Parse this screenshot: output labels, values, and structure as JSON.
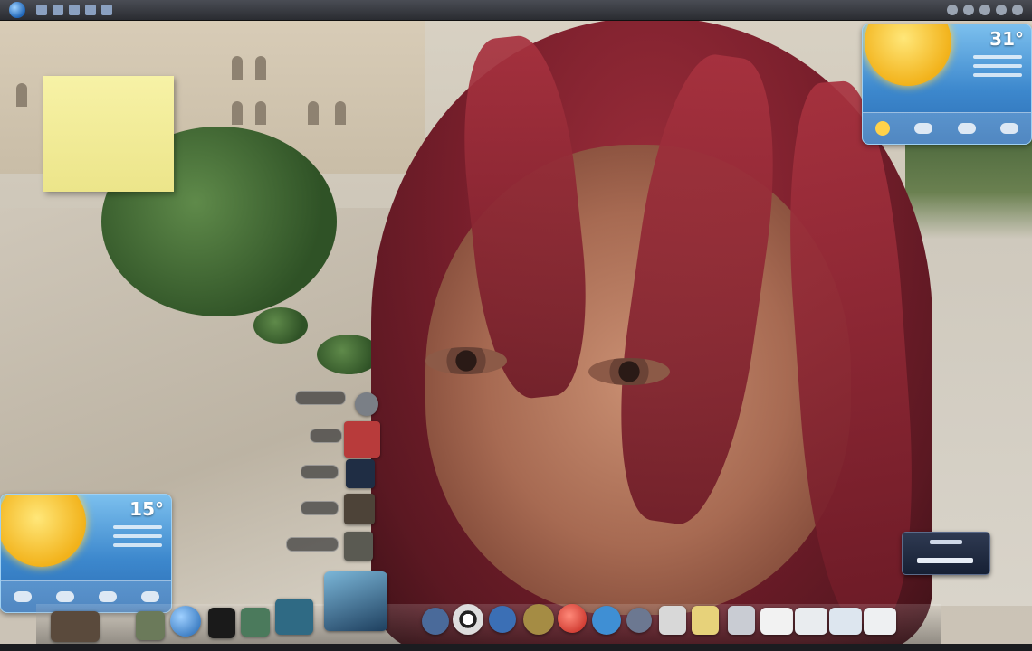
{
  "desktop": {
    "wallpaper": "photo-portrait-red-hair"
  },
  "taskbar": {
    "start_icon": "windows-orb-icon",
    "quick_launch_count": 5,
    "tray_icon_count": 5
  },
  "gadgets": {
    "sticky_note": {
      "lines": [
        "",
        "",
        "",
        ""
      ]
    },
    "weather_top": {
      "temperature": "31°",
      "icon": "sun-icon"
    },
    "weather_bottom": {
      "temperature": "15°",
      "icon": "sun-icon"
    }
  },
  "launcher": {
    "items": [
      {
        "icon": "globe-icon",
        "color": "#7a7f86"
      },
      {
        "icon": "calendar-icon",
        "color": "#b83b3b"
      },
      {
        "icon": "star-icon",
        "color": "#1f2d44"
      },
      {
        "icon": "photo-icon",
        "color": "#4d4338"
      },
      {
        "icon": "photo-icon",
        "color": "#5a5a52"
      }
    ]
  },
  "dock": {
    "colors": {
      "accent": "#3d88cd"
    }
  }
}
